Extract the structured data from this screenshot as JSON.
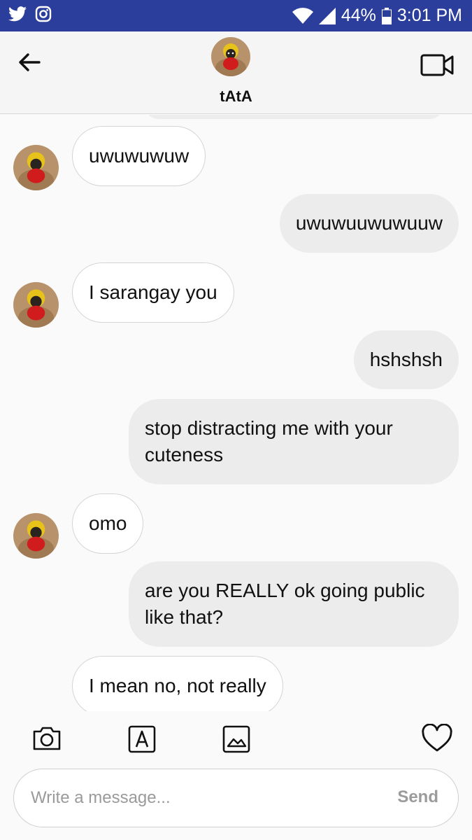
{
  "status_bar": {
    "battery": "44%",
    "time": "3:01 PM"
  },
  "header": {
    "contact_name": "tAtA"
  },
  "messages": [
    {
      "sender": "them",
      "text": "uwuwuwuw"
    },
    {
      "sender": "me",
      "text": "uwuwuuwuwuuw"
    },
    {
      "sender": "them",
      "text": "I sarangay you"
    },
    {
      "sender": "me",
      "text": "hshshsh"
    },
    {
      "sender": "me",
      "text": "stop distracting me with your cuteness"
    },
    {
      "sender": "them",
      "text": "omo"
    },
    {
      "sender": "me",
      "text": "are you REALLY ok going public like that?"
    },
    {
      "sender": "them",
      "text": "I mean no, not really"
    }
  ],
  "composer": {
    "placeholder": "Write a message...",
    "send_label": "Send"
  },
  "toolbar_icons": [
    "camera-icon",
    "text-icon",
    "gallery-icon",
    "heart-icon"
  ],
  "colors": {
    "status_bar": "#2c3e9c",
    "bubble_out": "#ececec",
    "bubble_in": "#ffffff"
  }
}
